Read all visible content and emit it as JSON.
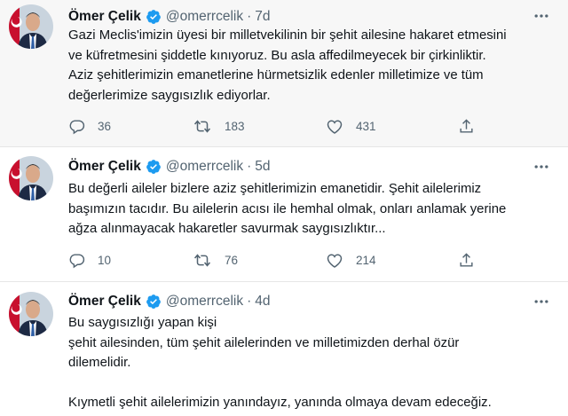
{
  "tweets": [
    {
      "name": "Ömer Çelik",
      "handle": "@omerrcelik",
      "separator": "·",
      "time": "7d",
      "lines": [
        "Gazi Meclis'imizin üyesi bir milletvekilinin bir şehit ailesine hakaret etmesini",
        "ve küfretmesini şiddetle kınıyoruz. Bu asla affedilmeyecek bir çirkinliktir.",
        "Aziz şehitlerimizin emanetlerine hürmetsizlik edenler milletimize ve tüm",
        "değerlerimize saygısızlık ediyorlar."
      ],
      "replies": "36",
      "retweets": "183",
      "likes": "431"
    },
    {
      "name": "Ömer Çelik",
      "handle": "@omerrcelik",
      "separator": "·",
      "time": "5d",
      "lines": [
        "Bu değerli aileler bizlere aziz şehitlerimizin emanetidir. Şehit ailelerimiz",
        "başımızın tacıdır. Bu ailelerin acısı ile hemhal olmak, onları anlamak yerine",
        "ağza alınmayacak hakaretler savurmak saygısızlıktır..."
      ],
      "replies": "10",
      "retweets": "76",
      "likes": "214"
    },
    {
      "name": "Ömer Çelik",
      "handle": "@omerrcelik",
      "separator": "·",
      "time": "4d",
      "lines": [
        "Bu saygısızlığı yapan kişi",
        "şehit ailesinden, tüm şehit ailelerinden ve milletimizden derhal özür",
        "dilemelidir.",
        "",
        "Kıymetli şehit ailelerimizin yanındayız, yanında olmaya devam edeceğiz."
      ]
    }
  ],
  "icons": {
    "verified": "verified-badge-icon",
    "more": "more-icon",
    "reply": "reply-icon",
    "retweet": "retweet-icon",
    "like": "like-icon",
    "share": "share-icon"
  },
  "colors": {
    "verified": "#1d9bf0",
    "muted": "#536471",
    "text": "#0f1419",
    "highlight_bg": "#f7f7f7"
  }
}
